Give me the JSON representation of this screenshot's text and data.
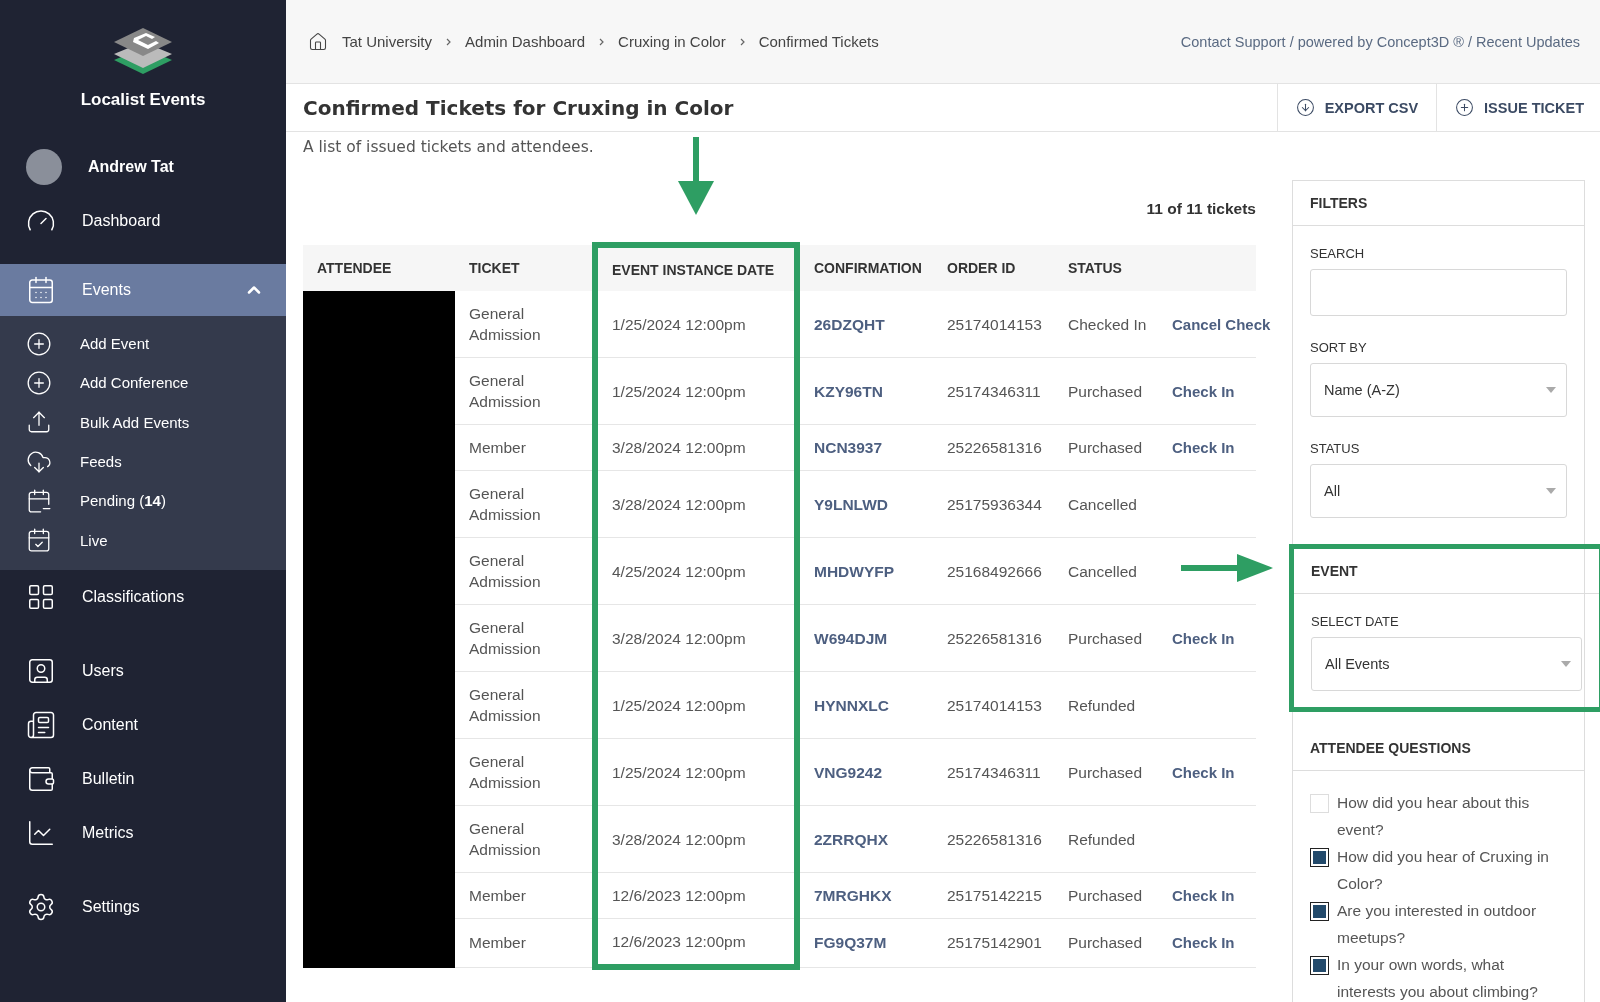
{
  "sidebar": {
    "brand": "Localist Events",
    "user": "Andrew Tat",
    "items": [
      {
        "label": "Dashboard",
        "selected": false
      },
      {
        "label": "Events",
        "selected": true,
        "expanded": true,
        "children": [
          {
            "label": "Add Event"
          },
          {
            "label": "Add Conference"
          },
          {
            "label": "Bulk Add Events"
          },
          {
            "label": "Feeds"
          },
          {
            "label": "Pending (**14**)"
          },
          {
            "label": "Live"
          }
        ]
      },
      {
        "label": "Classifications",
        "selected": false
      },
      {
        "label": "Users",
        "selected": false
      },
      {
        "label": "Content",
        "selected": false
      },
      {
        "label": "Bulletin",
        "selected": false
      },
      {
        "label": "Metrics",
        "selected": false
      },
      {
        "label": "Settings",
        "selected": false
      }
    ]
  },
  "breadcrumb": [
    "Tat University",
    "Admin Dashboard",
    "Cruxing in Color",
    "Confirmed Tickets"
  ],
  "top_links": "Contact Support / powered by Concept3D ® / Recent Updates",
  "page": {
    "title": "Confirmed Tickets for Cruxing in Color",
    "subtitle": "A list of issued tickets and attendees.",
    "buttons": [
      "EXPORT CSV",
      "ISSUE TICKET"
    ]
  },
  "table": {
    "count": "11 of 11 tickets",
    "columns": [
      {
        "label": "ATTENDEE",
        "highlighted": false
      },
      {
        "label": "TICKET",
        "highlighted": false
      },
      {
        "label": "EVENT INSTANCE DATE",
        "highlighted": true
      },
      {
        "label": "CONFIRMATION",
        "highlighted": false
      },
      {
        "label": "ORDER ID",
        "highlighted": false
      },
      {
        "label": "STATUS",
        "highlighted": false
      }
    ],
    "rows": [
      {
        "redacted": true,
        "ticket": "General Admission",
        "date": "1/25/2024 12:00pm",
        "confirmation": "26DZQHT",
        "order_id": "25174014153",
        "status": "Checked In",
        "action": "Cancel Check"
      },
      {
        "redacted": true,
        "ticket": "General Admission",
        "date": "1/25/2024 12:00pm",
        "confirmation": "KZY96TN",
        "order_id": "25174346311",
        "status": "Purchased",
        "action": "Check In"
      },
      {
        "redacted": true,
        "ticket": "Member",
        "date": "3/28/2024 12:00pm",
        "confirmation": "NCN3937",
        "order_id": "25226581316",
        "status": "Purchased",
        "action": "Check In"
      },
      {
        "redacted": true,
        "ticket": "General Admission",
        "date": "3/28/2024 12:00pm",
        "confirmation": "Y9LNLWD",
        "order_id": "25175936344",
        "status": "Cancelled"
      },
      {
        "redacted": true,
        "ticket": "General Admission",
        "date": "4/25/2024 12:00pm",
        "confirmation": "MHDWYFP",
        "order_id": "25168492666",
        "status": "Cancelled"
      },
      {
        "redacted": true,
        "ticket": "General Admission",
        "date": "3/28/2024 12:00pm",
        "confirmation": "W694DJM",
        "order_id": "25226581316",
        "status": "Purchased",
        "action": "Check In"
      },
      {
        "redacted": true,
        "ticket": "General Admission",
        "date": "1/25/2024 12:00pm",
        "confirmation": "HYNNXLC",
        "order_id": "25174014153",
        "status": "Refunded"
      },
      {
        "redacted": true,
        "ticket": "General Admission",
        "date": "1/25/2024 12:00pm",
        "confirmation": "VNG9242",
        "order_id": "25174346311",
        "status": "Purchased",
        "action": "Check In"
      },
      {
        "redacted": true,
        "ticket": "General Admission",
        "date": "3/28/2024 12:00pm",
        "confirmation": "2ZRRQHX",
        "order_id": "25226581316",
        "status": "Refunded"
      },
      {
        "redacted": true,
        "ticket": "Member",
        "date": "12/6/2023 12:00pm",
        "confirmation": "7MRGHKX",
        "order_id": "25175142215",
        "status": "Purchased",
        "action": "Check In"
      },
      {
        "redacted": true,
        "ticket": "Member",
        "date": "12/6/2023 12:00pm",
        "confirmation": "FG9Q37M",
        "order_id": "25175142901",
        "status": "Purchased",
        "action": "Check In"
      }
    ]
  },
  "filters": {
    "title": "FILTERS",
    "search_label": "SEARCH",
    "sort_label": "SORT BY",
    "sort_value": "Name (A-Z)",
    "status_label": "STATUS",
    "status_value": "All",
    "event": {
      "title": "EVENT",
      "highlighted": true,
      "date_label": "SELECT DATE",
      "date_value": "All Events"
    },
    "questions": {
      "title": "ATTENDEE QUESTIONS",
      "items": [
        {
          "label": "How did you hear about this event?",
          "checked": false
        },
        {
          "label": "How did you hear of Cruxing in Color?",
          "checked": true
        },
        {
          "label": "Are you interested in outdoor meetups?",
          "checked": true
        },
        {
          "label": "In your own words, what interests you about climbing?",
          "checked": true
        }
      ]
    }
  }
}
